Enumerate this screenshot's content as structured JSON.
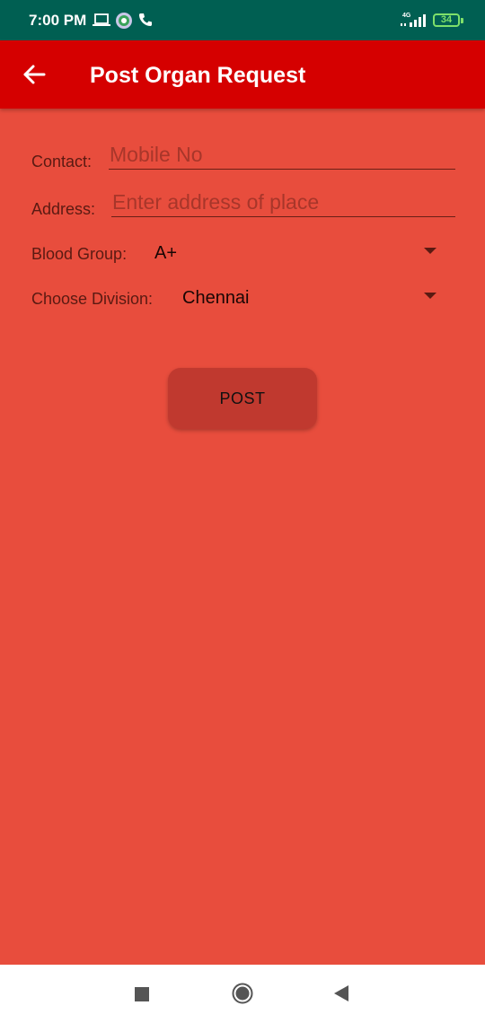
{
  "status_bar": {
    "time": "7:00 PM",
    "network": "4G",
    "battery": "34",
    "icons": [
      "laptop-icon",
      "whatsapp-icon",
      "phone-icon",
      "signal-icon",
      "battery-icon"
    ]
  },
  "app_bar": {
    "title": "Post Organ Request",
    "back_icon": "arrow-left-icon",
    "color": "#d50000"
  },
  "form": {
    "contact_label": "Contact:",
    "contact_placeholder": "Mobile No",
    "contact_value": "",
    "address_label": "Address:",
    "address_placeholder": "Enter address of place",
    "address_value": "",
    "blood_group_label": "Blood Group:",
    "blood_group_value": "A+",
    "division_label": "Choose Division:",
    "division_value": "Chennai"
  },
  "post_button": {
    "label": "POST"
  },
  "nav_bar": {
    "icons": [
      "recents-icon",
      "home-icon",
      "back-icon"
    ]
  },
  "colors": {
    "background": "#e84d3d",
    "status_bar": "#005f52",
    "button": "#c0392f"
  }
}
